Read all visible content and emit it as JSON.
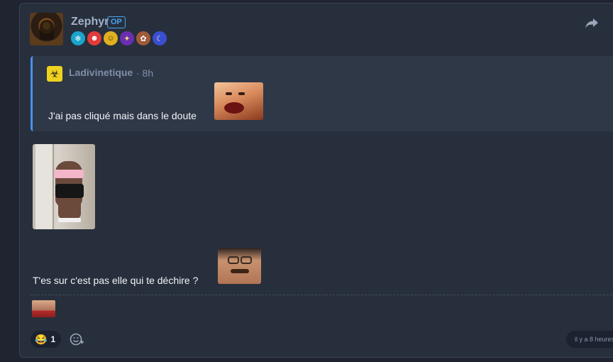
{
  "post": {
    "author": "Zephyr",
    "op_badge": "OP",
    "badges": [
      {
        "icon": "shield-badge-icon",
        "color": "#1aa5c9",
        "glyph": "❄"
      },
      {
        "icon": "clown-badge-icon",
        "color": "#e23b3b",
        "glyph": "☻"
      },
      {
        "icon": "smiley-badge-icon",
        "color": "#e0b020",
        "glyph": "☺"
      },
      {
        "icon": "wizard-badge-icon",
        "color": "#6a2fb0",
        "glyph": "✦"
      },
      {
        "icon": "dog-badge-icon",
        "color": "#a05a3a",
        "glyph": "✿"
      },
      {
        "icon": "moon-badge-icon",
        "color": "#3a4fd0",
        "glyph": "☾"
      }
    ],
    "quote": {
      "author": "Ladivinetique",
      "time": "· 8h",
      "text": "J'ai pas cliqué mais dans le doute"
    },
    "text": "T'es sur c'est pas elle qui te déchire ?",
    "reaction": {
      "emoji": "😂",
      "count": "1"
    },
    "timestamp": "il y a 8 heures"
  }
}
